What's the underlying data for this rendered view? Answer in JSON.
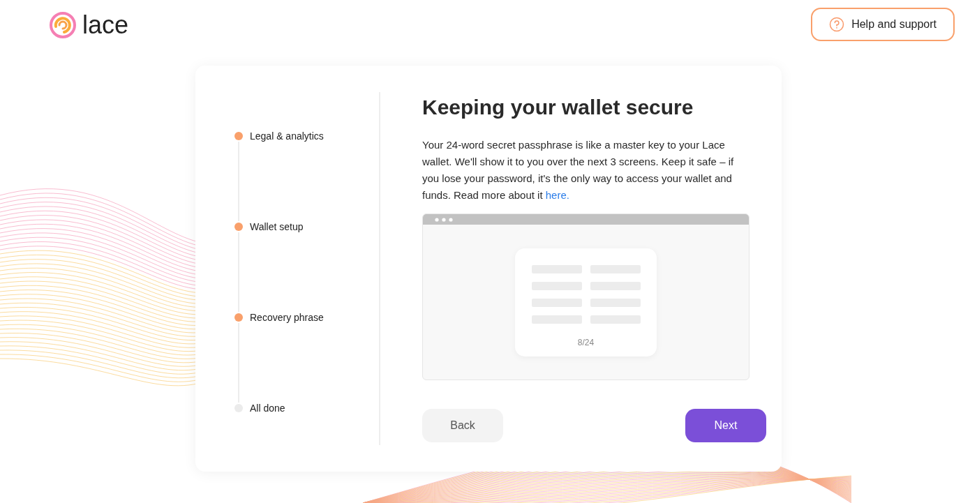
{
  "header": {
    "logo_text": "lace",
    "help_button": "Help and support"
  },
  "steps": [
    {
      "label": "Legal & analytics",
      "completed": true
    },
    {
      "label": "Wallet setup",
      "completed": true
    },
    {
      "label": "Recovery phrase",
      "completed": true
    },
    {
      "label": "All done",
      "completed": false
    }
  ],
  "content": {
    "title": "Keeping your wallet secure",
    "description": "Your 24-word secret passphrase is like a master key to your Lace wallet. We'll show it to you over the next 3 screens. Keep it safe – if you lose your password, it's the only way to access your wallet and funds. Read more about it ",
    "link_text": "here.",
    "illustration": {
      "counter": "8/24"
    }
  },
  "buttons": {
    "back": "Back",
    "next": "Next"
  }
}
